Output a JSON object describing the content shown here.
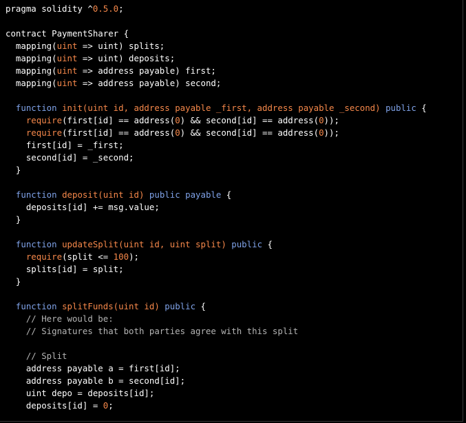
{
  "colors": {
    "background": "#000000",
    "plain": "#ffffff",
    "keyword": "#7fa2e8",
    "function_name": "#f6884a",
    "number": "#f6884a",
    "comment": "#b4b4b4"
  },
  "code": {
    "language": "solidity",
    "lines": [
      [
        [
          "p",
          "pragma solidity ^"
        ],
        [
          "n",
          "0.5.0"
        ],
        [
          "p",
          ";"
        ]
      ],
      [],
      [
        [
          "p",
          "contract PaymentSharer {"
        ]
      ],
      [
        [
          "p",
          "  mapping("
        ],
        [
          "f",
          "uint"
        ],
        [
          "p",
          " => uint) splits;"
        ]
      ],
      [
        [
          "p",
          "  mapping("
        ],
        [
          "f",
          "uint"
        ],
        [
          "p",
          " => uint) deposits;"
        ]
      ],
      [
        [
          "p",
          "  mapping("
        ],
        [
          "f",
          "uint"
        ],
        [
          "p",
          " => address payable) first;"
        ]
      ],
      [
        [
          "p",
          "  mapping("
        ],
        [
          "f",
          "uint"
        ],
        [
          "p",
          " => address payable) second;"
        ]
      ],
      [],
      [
        [
          "p",
          "  "
        ],
        [
          "k",
          "function"
        ],
        [
          "p",
          " "
        ],
        [
          "f",
          "init(uint id, address payable _first, address payable _second)"
        ],
        [
          "p",
          " "
        ],
        [
          "k",
          "public"
        ],
        [
          "p",
          " {"
        ]
      ],
      [
        [
          "p",
          "    "
        ],
        [
          "f",
          "require"
        ],
        [
          "p",
          "(first[id] == address("
        ],
        [
          "n",
          "0"
        ],
        [
          "p",
          ") && second[id] == address("
        ],
        [
          "n",
          "0"
        ],
        [
          "p",
          "));"
        ]
      ],
      [
        [
          "p",
          "    "
        ],
        [
          "f",
          "require"
        ],
        [
          "p",
          "(first[id] == address("
        ],
        [
          "n",
          "0"
        ],
        [
          "p",
          ") && second[id] == address("
        ],
        [
          "n",
          "0"
        ],
        [
          "p",
          "));"
        ]
      ],
      [
        [
          "p",
          "    first[id] = _first;"
        ]
      ],
      [
        [
          "p",
          "    second[id] = _second;"
        ]
      ],
      [
        [
          "p",
          "  }"
        ]
      ],
      [],
      [
        [
          "p",
          "  "
        ],
        [
          "k",
          "function"
        ],
        [
          "p",
          " "
        ],
        [
          "f",
          "deposit(uint id)"
        ],
        [
          "p",
          " "
        ],
        [
          "k",
          "public payable"
        ],
        [
          "p",
          " {"
        ]
      ],
      [
        [
          "p",
          "    deposits[id] += msg.value;"
        ]
      ],
      [
        [
          "p",
          "  }"
        ]
      ],
      [],
      [
        [
          "p",
          "  "
        ],
        [
          "k",
          "function"
        ],
        [
          "p",
          " "
        ],
        [
          "f",
          "updateSplit(uint id, uint split)"
        ],
        [
          "p",
          " "
        ],
        [
          "k",
          "public"
        ],
        [
          "p",
          " {"
        ]
      ],
      [
        [
          "p",
          "    "
        ],
        [
          "f",
          "require"
        ],
        [
          "p",
          "(split <= "
        ],
        [
          "n",
          "100"
        ],
        [
          "p",
          ");"
        ]
      ],
      [
        [
          "p",
          "    splits[id] = split;"
        ]
      ],
      [
        [
          "p",
          "  }"
        ]
      ],
      [],
      [
        [
          "p",
          "  "
        ],
        [
          "k",
          "function"
        ],
        [
          "p",
          " "
        ],
        [
          "f",
          "splitFunds(uint id)"
        ],
        [
          "p",
          " "
        ],
        [
          "k",
          "public"
        ],
        [
          "p",
          " {"
        ]
      ],
      [
        [
          "c",
          "    // Here would be:"
        ]
      ],
      [
        [
          "c",
          "    // Signatures that both parties agree with this split"
        ]
      ],
      [],
      [
        [
          "c",
          "    // Split"
        ]
      ],
      [
        [
          "p",
          "    address payable a = first[id];"
        ]
      ],
      [
        [
          "p",
          "    address payable b = second[id];"
        ]
      ],
      [
        [
          "p",
          "    uint depo = deposits[id];"
        ]
      ],
      [
        [
          "p",
          "    deposits[id] = "
        ],
        [
          "n",
          "0"
        ],
        [
          "p",
          ";"
        ]
      ]
    ]
  }
}
